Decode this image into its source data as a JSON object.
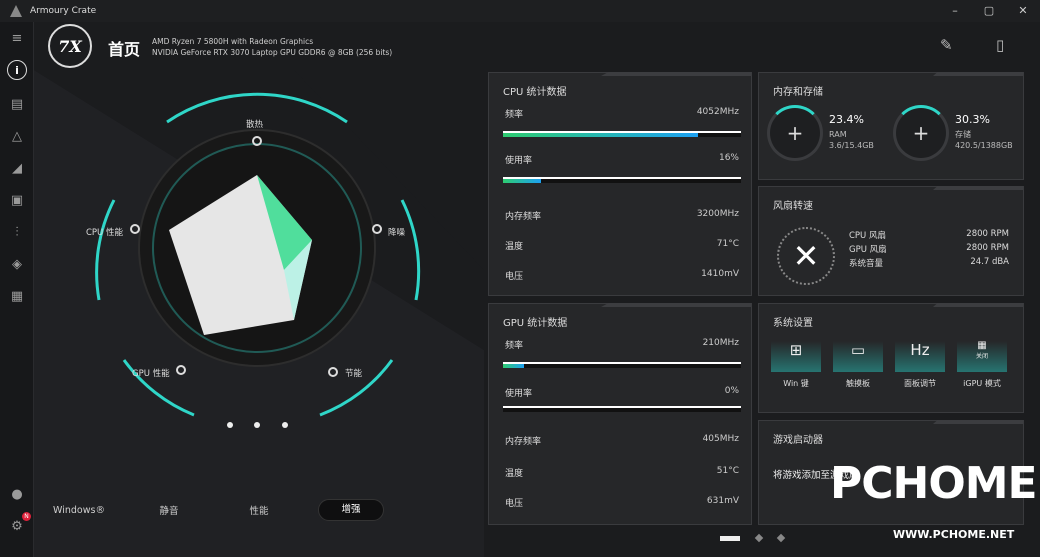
{
  "titlebar": {
    "title": "Armoury Crate",
    "minimize": "–",
    "maximize": "▢",
    "close": "✕"
  },
  "header": {
    "page_title": "首页",
    "cpu": "AMD Ryzen 7 5800H with Radeon Graphics",
    "gpu": "NVIDIA GeForce RTX 3070 Laptop GPU GDDR6 @ 8GB (256 bits)",
    "logo": "7X"
  },
  "radar": {
    "labels": {
      "top": "散热",
      "left": "CPU 性能",
      "right": "降噪",
      "bottom_left": "GPU 性能",
      "bottom_right": "节能"
    }
  },
  "modes": {
    "windows": "Windows®",
    "silent": "静音",
    "performance": "性能",
    "turbo": "增强",
    "selected": "增强"
  },
  "cpu": {
    "title": "CPU 统计数据",
    "freq_label": "频率",
    "freq_value": "4052MHz",
    "freq_fraction": 0.82,
    "usage_label": "使用率",
    "usage_value": "16%",
    "usage_fraction": 0.16,
    "mem_freq_label": "内存频率",
    "mem_freq_value": "3200MHz",
    "temp_label": "温度",
    "temp_value": "71°C",
    "volt_label": "电压",
    "volt_value": "1410mV"
  },
  "gpu": {
    "title": "GPU 统计数据",
    "freq_label": "频率",
    "freq_value": "210MHz",
    "freq_fraction": 0.09,
    "usage_label": "使用率",
    "usage_value": "0%",
    "usage_fraction": 0,
    "mem_freq_label": "内存频率",
    "mem_freq_value": "405MHz",
    "temp_label": "温度",
    "temp_value": "51°C",
    "volt_label": "电压",
    "volt_value": "631mV"
  },
  "memory": {
    "title": "内存和存储",
    "ram_pct": "23.4%",
    "ram_label": "RAM",
    "ram_detail": "3.6/15.4GB",
    "storage_pct": "30.3%",
    "storage_label": "存储",
    "storage_detail": "420.5/1388GB"
  },
  "fan": {
    "title": "风扇转速",
    "cpu_label": "CPU 风扇",
    "cpu_value": "2800 RPM",
    "gpu_label": "GPU 风扇",
    "gpu_value": "2800 RPM",
    "noise_label": "系统音量",
    "noise_value": "24.7 dBA"
  },
  "settings": {
    "title": "系统设置",
    "items": [
      {
        "label": "Win 键",
        "icon": "windows-key-icon"
      },
      {
        "label": "触摸板",
        "icon": "touchpad-icon"
      },
      {
        "label": "面板调节",
        "icon": "panel-overdrive-icon"
      },
      {
        "label": "iGPU 模式",
        "icon": "igpu-icon",
        "state": "关闭"
      }
    ]
  },
  "launcher": {
    "title": "游戏启动器",
    "hint": "将游戏添加至游戏库"
  },
  "watermark": {
    "text": "PCHOME",
    "sub": "WWW.PCHOME.NET"
  },
  "sidebar": {
    "badge": "N"
  },
  "colors": {
    "accent": "#2fd6c8",
    "bg": "#1b1c1e",
    "panel": "#262729"
  }
}
